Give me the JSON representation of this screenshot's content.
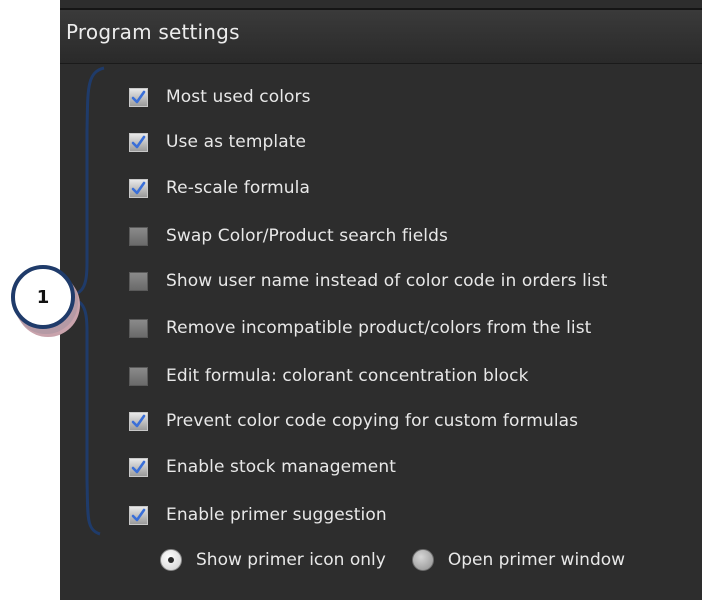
{
  "panel": {
    "title": "Program settings"
  },
  "settings": [
    {
      "label": "Most used colors",
      "checked": true
    },
    {
      "label": "Use as template",
      "checked": true
    },
    {
      "label": "Re-scale formula",
      "checked": true
    },
    {
      "label": "Swap Color/Product search fields",
      "checked": false
    },
    {
      "label": "Show user name instead of color code in orders list",
      "checked": false
    },
    {
      "label": "Remove incompatible product/colors from the list",
      "checked": false
    },
    {
      "label": "Edit formula: colorant concentration block",
      "checked": false
    },
    {
      "label": "Prevent color code copying for custom formulas",
      "checked": true
    },
    {
      "label": "Enable stock management",
      "checked": true
    },
    {
      "label": "Enable primer suggestion",
      "checked": true
    }
  ],
  "primer_options": [
    {
      "label": "Show primer icon only",
      "selected": true
    },
    {
      "label": "Open primer window",
      "selected": false
    }
  ],
  "callout": {
    "number": "1"
  },
  "colors": {
    "panel_bg": "#2d2d2d",
    "check_blue": "#3a6fd8",
    "brace_blue": "#1f3b6a"
  }
}
